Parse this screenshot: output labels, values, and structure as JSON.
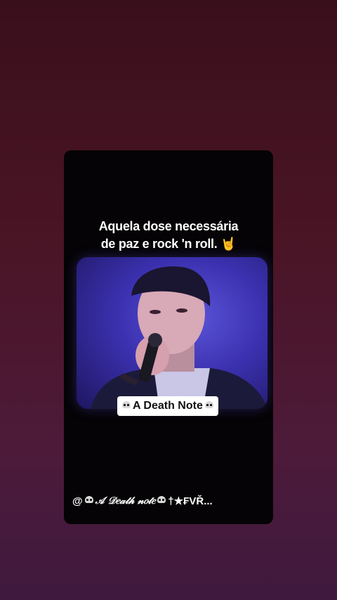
{
  "story": {
    "caption_line1": "Aquela dose necessária",
    "caption_line2": "de paz e rock 'n roll. 🤘",
    "tag_label": "A Death Note",
    "author_prefix": "@",
    "author_name": "𝒜 𝒟𝑒𝒶𝓉𝒽 𝓃𝑜𝓉𝑒",
    "author_suffix": "†★₣VŘ..."
  },
  "icons": {
    "skull": "skull-icon"
  }
}
